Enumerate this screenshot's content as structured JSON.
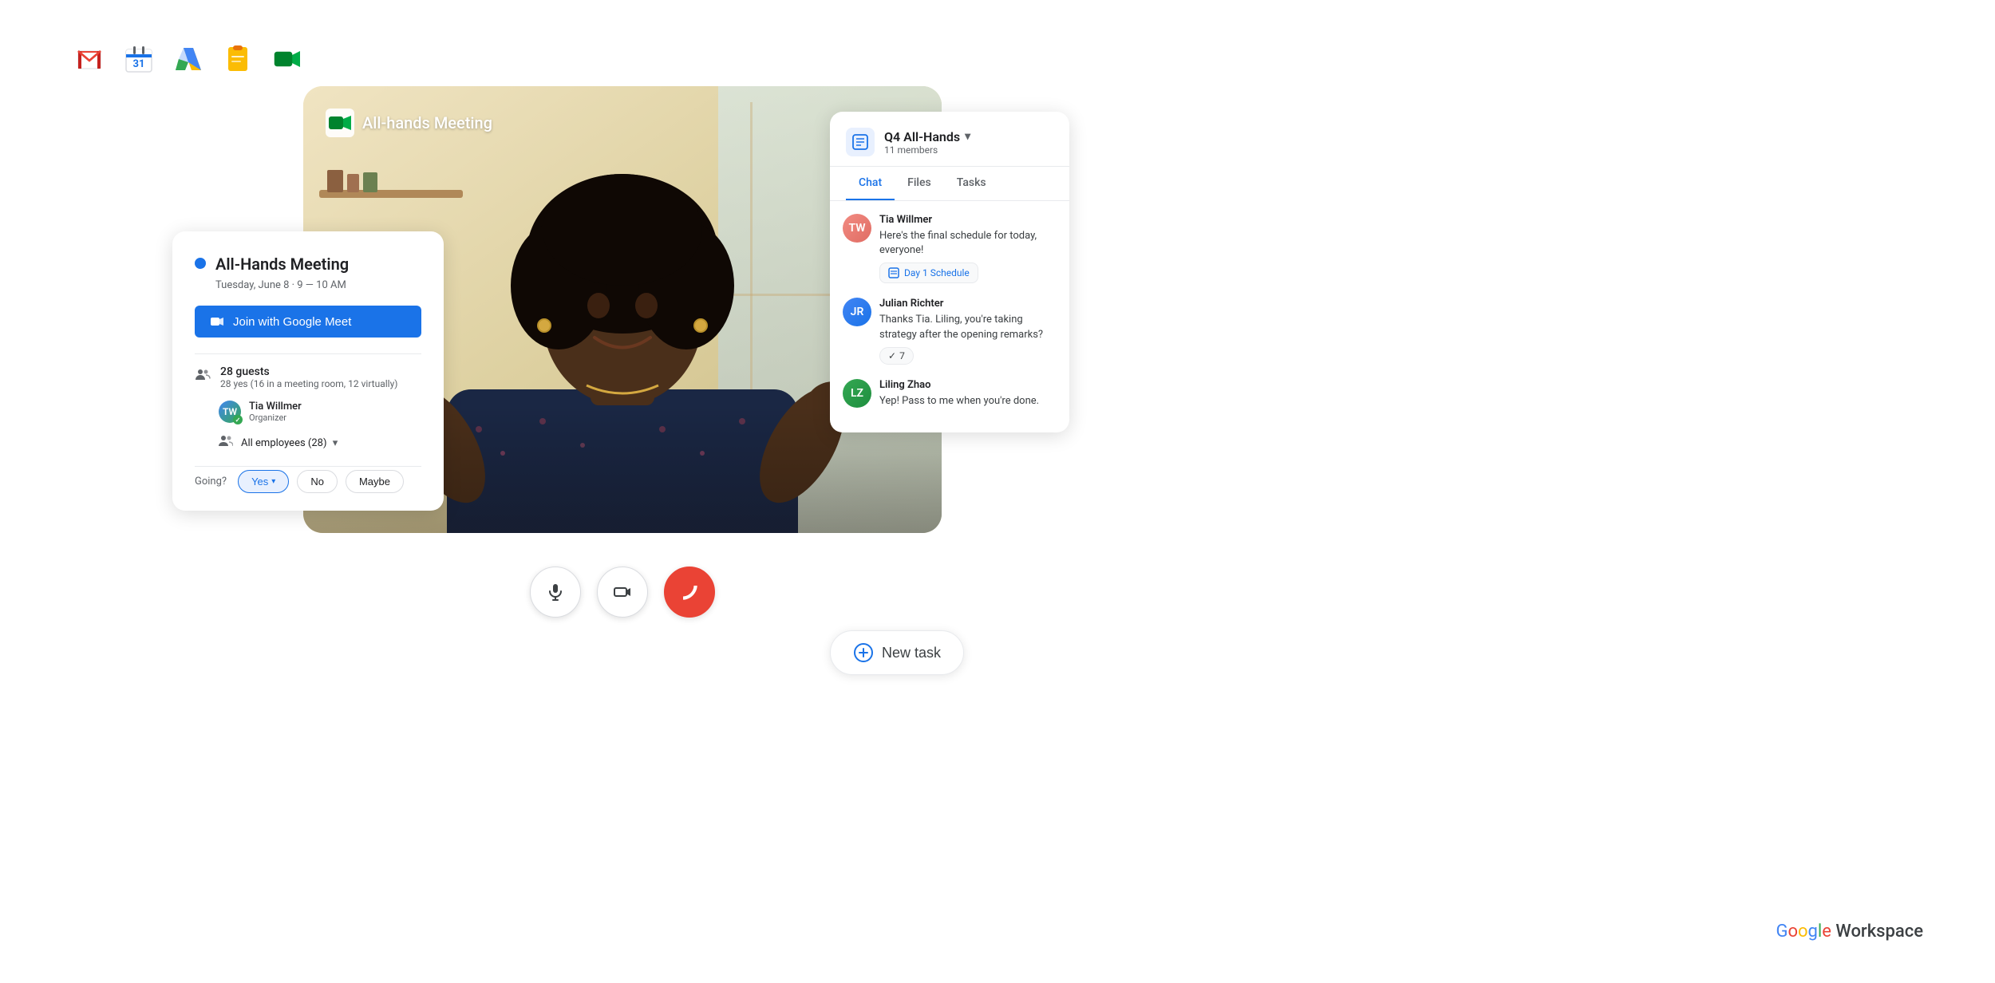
{
  "toolbar": {
    "apps": [
      {
        "name": "Gmail",
        "label": "M",
        "colors": [
          "#EA4335",
          "#C5221F",
          "#FBBC04",
          "#34A853"
        ]
      },
      {
        "name": "Calendar",
        "label": "31"
      },
      {
        "name": "Drive",
        "label": "△"
      },
      {
        "name": "Keep",
        "label": "◻"
      },
      {
        "name": "Meet",
        "label": "▶"
      }
    ]
  },
  "video": {
    "title": "All-hands Meeting",
    "meet_icon": "meet"
  },
  "controls": {
    "mic_label": "microphone",
    "camera_label": "camera",
    "hangup_label": "hang up"
  },
  "calendar_card": {
    "event_title": "All-Hands Meeting",
    "event_date": "Tuesday, June 8 · 9 — 10 AM",
    "join_button": "Join with Google Meet",
    "guests_count": "28 guests",
    "guests_detail": "28 yes (16 in a meeting room, 12 virtually)",
    "organizer_name": "Tia Willmer",
    "organizer_role": "Organizer",
    "all_employees": "All employees (28)",
    "going_label": "Going?",
    "rsvp_yes": "Yes",
    "rsvp_no": "No",
    "rsvp_maybe": "Maybe"
  },
  "chat_panel": {
    "group_name": "Q4 All-Hands",
    "members_count": "11 members",
    "tabs": [
      {
        "label": "Chat",
        "active": true
      },
      {
        "label": "Files",
        "active": false
      },
      {
        "label": "Tasks",
        "active": false
      }
    ],
    "messages": [
      {
        "author": "Tia Willmer",
        "avatar_initials": "TW",
        "avatar_color": "#f28b82",
        "text": "Here's the final schedule for today, everyone!",
        "attachment": "Day 1 Schedule",
        "reaction": null
      },
      {
        "author": "Julian Richter",
        "avatar_initials": "JR",
        "avatar_color": "#aecbfa",
        "text": "Thanks Tia. Liling, you're taking strategy after the opening remarks?",
        "attachment": null,
        "reaction": "7"
      },
      {
        "author": "Liling Zhao",
        "avatar_initials": "LZ",
        "avatar_color": "#ccff90",
        "text": "Yep! Pass to me when you're done.",
        "attachment": null,
        "reaction": null
      }
    ]
  },
  "new_task": {
    "label": "New task"
  },
  "branding": {
    "google": "Google",
    "workspace": "Workspace"
  }
}
